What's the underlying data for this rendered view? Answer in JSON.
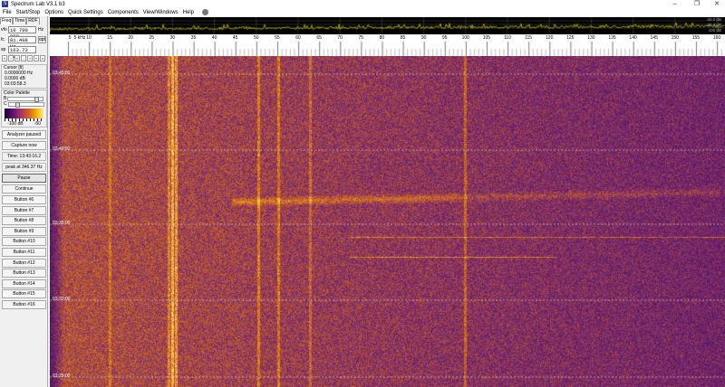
{
  "window": {
    "title": "Spectrum Lab V3.1 b3",
    "minimize": "–",
    "restore": "❐",
    "close": "✕"
  },
  "menu": [
    "File",
    "Start/Stop",
    "Options",
    "Quick Settings",
    "Components",
    "View/Windows",
    "Help"
  ],
  "left": {
    "tabs": [
      "Freq",
      "Time",
      "RDF"
    ],
    "vfo": {
      "label": "vfo",
      "value": "10 700 000",
      "unit": "Hz"
    },
    "fc": {
      "label": "fc",
      "value": "81.408 Hz",
      "button": "opt"
    },
    "sp": {
      "label": "sp",
      "value": "163.73 Hz"
    },
    "arrows": [
      "«",
      "‹",
      "«",
      "-",
      "+",
      "»",
      "v"
    ],
    "cursor": {
      "title": "Cursor [fi]",
      "freq": "0.0000000 Hz",
      "level": "0.0000 dB",
      "time": "03:03:58.3"
    },
    "palette": {
      "title": "Color Palette",
      "b": "B",
      "c": "C",
      "min": "-100 dB",
      "max": "-50",
      "brightness": 0.82,
      "contrast": 0.2
    },
    "buttons": {
      "analyzer": "Analyzer paused",
      "capture": "Capture now",
      "time": "Time:  13:43:16.2",
      "peak": "peak at 346.37 Hz",
      "pause": "Pause",
      "continue": "Continue"
    },
    "user_buttons": [
      "Button #6",
      "Button #7",
      "Button #8",
      "Button #9",
      "Button #10",
      "Button #11",
      "Button #12",
      "Button #13",
      "Button #14",
      "Button #15",
      "Button #16"
    ]
  },
  "spectrum": {
    "db_labels": [
      "60.0 dB",
      "80.0 dB",
      "100 dB"
    ],
    "trace_color": "#c8c000"
  },
  "freq_axis": {
    "unit_label": "5 kHz",
    "ticks": [
      "10",
      "15",
      "20",
      "25",
      "30",
      "35",
      "40",
      "45",
      "50",
      "55",
      "60",
      "65",
      "70",
      "75",
      "80",
      "85",
      "90",
      "95",
      "100",
      "105",
      "110",
      "115",
      "120",
      "125",
      "130",
      "135",
      "140",
      "145",
      "150",
      "155",
      "160"
    ],
    "first_tick": "5"
  },
  "waterfall": {
    "time_labels": [
      "03:45:00",
      "03:40:00",
      "03:35:00",
      "03:30:00",
      "03:25:00"
    ]
  }
}
